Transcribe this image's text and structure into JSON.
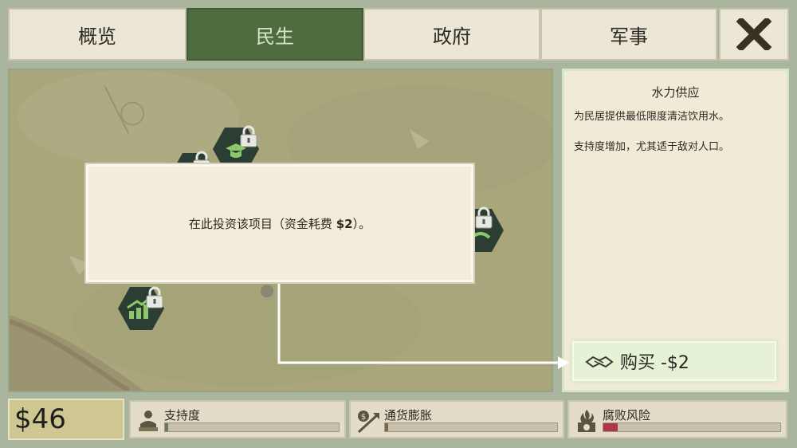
{
  "tabs": [
    {
      "label": "概览",
      "active": false
    },
    {
      "label": "民生",
      "active": true
    },
    {
      "label": "政府",
      "active": false
    },
    {
      "label": "军事",
      "active": false
    }
  ],
  "close_icon": "close-x-icon",
  "popup": {
    "text_prefix": "在此投资该项目（资金耗费 ",
    "cost": "$2",
    "text_suffix": "）。"
  },
  "panel": {
    "title": "水力供应",
    "desc1": "为民居提供最低限度清洁饮用水。",
    "desc2": "支持度增加，尤其适于敌对人口。",
    "buy_label": "购买 -$2",
    "buy_icon": "handshake-icon"
  },
  "status": {
    "money": "$46",
    "stats": [
      {
        "label": "支持度",
        "icon": "crowd-icon",
        "level": 0.02,
        "color": "#6b7a5a"
      },
      {
        "label": "通货膨胀",
        "icon": "inflation-arrow-icon",
        "level": 0.02,
        "color": "#7a6b45"
      },
      {
        "label": "腐败风险",
        "icon": "money-fire-icon",
        "level": 0.08,
        "color": "#b0344a"
      }
    ]
  },
  "colors": {
    "active_tab": "#4f6b40",
    "panel_bg": "#f1ead7",
    "buy_glow": "#c8e3ae"
  }
}
